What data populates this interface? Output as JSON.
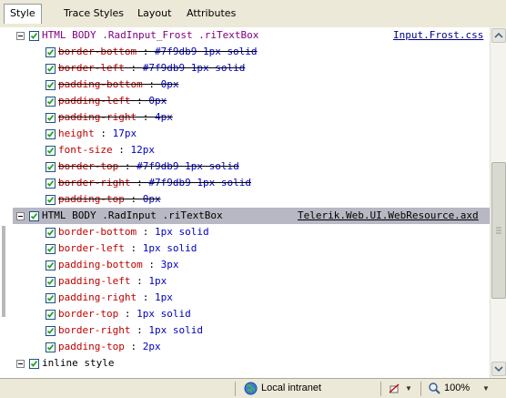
{
  "tabs": [
    {
      "label": "Style",
      "active": true
    },
    {
      "label": "Trace Styles",
      "active": false
    },
    {
      "label": "Layout",
      "active": false
    },
    {
      "label": "Attributes",
      "active": false
    }
  ],
  "rules": [
    {
      "selector": "HTML BODY .RadInput_Frost .riTextBox",
      "source": "Input.Frost.css",
      "overridden": true,
      "properties": [
        {
          "name": "border-bottom",
          "value": "#7f9db9 1px solid"
        },
        {
          "name": "border-left",
          "value": "#7f9db9 1px solid"
        },
        {
          "name": "padding-bottom",
          "value": "0px"
        },
        {
          "name": "padding-left",
          "value": "0px"
        },
        {
          "name": "padding-right",
          "value": "4px"
        },
        {
          "name": "height",
          "value": "17px",
          "active": true
        },
        {
          "name": "font-size",
          "value": "12px",
          "active": true
        },
        {
          "name": "border-top",
          "value": "#7f9db9 1px solid"
        },
        {
          "name": "border-right",
          "value": "#7f9db9 1px solid"
        },
        {
          "name": "padding-top",
          "value": "0px"
        }
      ]
    },
    {
      "selector": "HTML BODY .RadInput .riTextBox",
      "source": "Telerik.Web.UI.WebResource.axd",
      "properties": [
        {
          "name": "border-bottom",
          "value": "1px solid"
        },
        {
          "name": "border-left",
          "value": "1px solid"
        },
        {
          "name": "padding-bottom",
          "value": "3px"
        },
        {
          "name": "padding-left",
          "value": "1px"
        },
        {
          "name": "padding-right",
          "value": "1px"
        },
        {
          "name": "border-top",
          "value": "1px solid"
        },
        {
          "name": "border-right",
          "value": "1px solid"
        },
        {
          "name": "padding-top",
          "value": "2px"
        }
      ]
    }
  ],
  "inline_style": {
    "label": "inline style"
  },
  "status": {
    "zone": "Local intranet",
    "zoom": "100%"
  }
}
